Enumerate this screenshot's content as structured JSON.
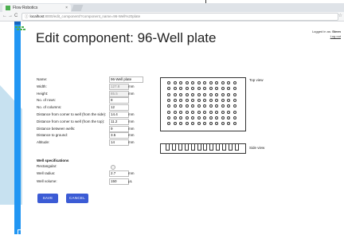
{
  "browser": {
    "tab_title": "Flow Robotics",
    "tab_close": "×",
    "url_host": "localhost",
    "url_path": ":8000/edit_component/?component_name=96-Well%20plate",
    "back": "←",
    "forward": "→",
    "reload": "C",
    "lock": "ⓘ",
    "star": "☆"
  },
  "header": {
    "logged_in_prefix": "Logged in as:",
    "user": "Steen",
    "logout": "Log out"
  },
  "title": "Edit component: 96-Well plate",
  "fields": [
    {
      "label": "Name:",
      "value": "96-Well plate",
      "unit": "",
      "disabled": false,
      "wide": true
    },
    {
      "label": "Width:",
      "value": "127.8",
      "unit": "mm",
      "disabled": true,
      "wide": false
    },
    {
      "label": "Height:",
      "value": "85.5",
      "unit": "mm",
      "disabled": true,
      "wide": false
    },
    {
      "label": "No. of rows:",
      "value": "8",
      "unit": "",
      "disabled": false,
      "wide": false
    },
    {
      "label": "No. of columns:",
      "value": "12",
      "unit": "",
      "disabled": false,
      "wide": false
    },
    {
      "label": "Distance from corner to well (from the side):",
      "value": "14.4",
      "unit": "mm",
      "disabled": false,
      "wide": false
    },
    {
      "label": "Distance from corner to well (from the top):",
      "value": "11.2",
      "unit": "mm",
      "disabled": false,
      "wide": false
    },
    {
      "label": "Distance between wells:",
      "value": "9",
      "unit": "mm",
      "disabled": false,
      "wide": false
    },
    {
      "label": "Distance to ground:",
      "value": "3.5",
      "unit": "mm",
      "disabled": false,
      "wide": false
    },
    {
      "label": "Altitude:",
      "value": "14",
      "unit": "mm",
      "disabled": false,
      "wide": false
    }
  ],
  "well_specs": {
    "heading": "Well specifications",
    "rectangular_label": "Rectangular:",
    "radius_label": "Well radius:",
    "radius_value": "2.7",
    "radius_unit": "mm",
    "volume_label": "Well volume:",
    "volume_value": "150",
    "volume_unit": "μL"
  },
  "buttons": {
    "save": "SAVE",
    "cancel": "CANCEL"
  },
  "views": {
    "top_label": "Top view",
    "side_label": "Side view",
    "rows": 8,
    "columns": 12
  },
  "colors": {
    "accent": "#2196f3",
    "button": "#3b5bd5",
    "logo": "#4caf50"
  }
}
